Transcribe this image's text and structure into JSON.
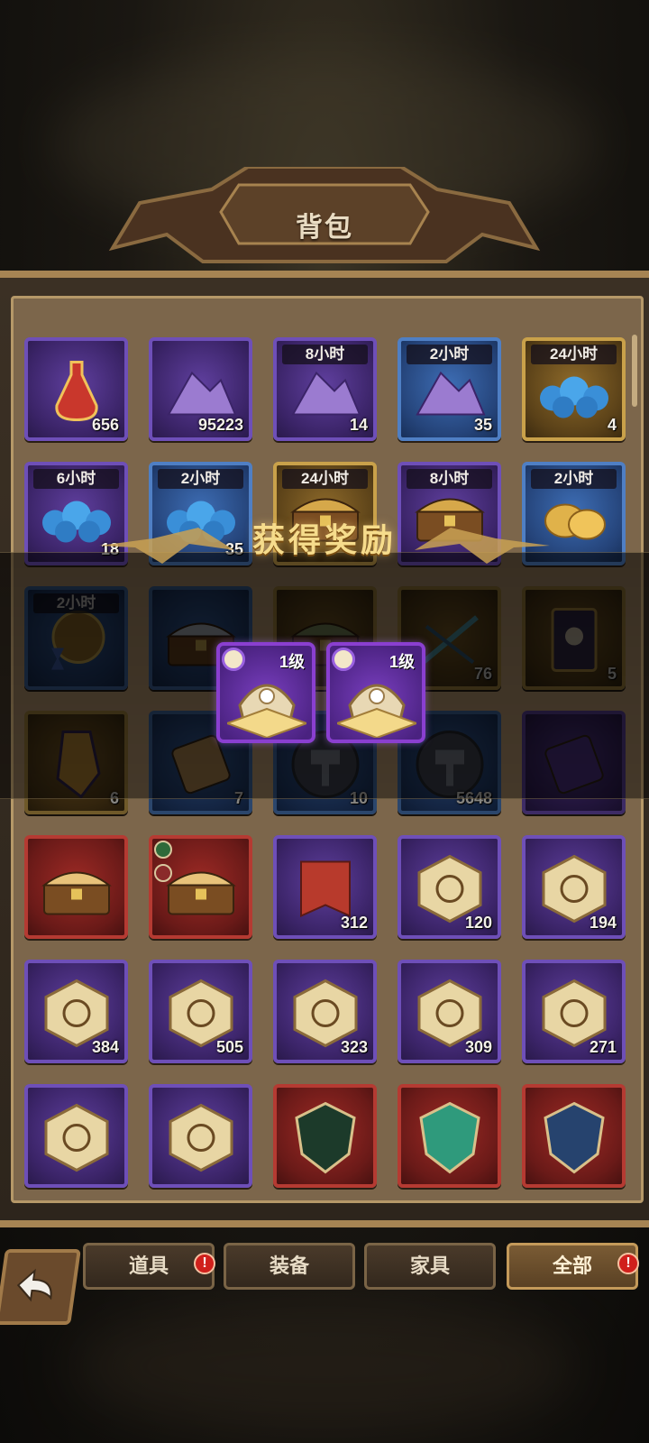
{
  "header": {
    "title": "背包"
  },
  "grid": [
    [
      {
        "name": "potion",
        "count": "656",
        "time": "",
        "style": ""
      },
      {
        "name": "purple-dust",
        "count": "95223",
        "time": "",
        "style": ""
      },
      {
        "name": "dust-chest",
        "count": "14",
        "time": "8小时",
        "style": ""
      },
      {
        "name": "purple-dust-pile",
        "count": "35",
        "time": "2小时",
        "style": "blue"
      },
      {
        "name": "orb-chest",
        "count": "4",
        "time": "24小时",
        "style": "gold"
      }
    ],
    [
      {
        "name": "blue-orbs",
        "count": "18",
        "time": "6小时",
        "style": ""
      },
      {
        "name": "blue-orbs",
        "count": "35",
        "time": "2小时",
        "style": "blue"
      },
      {
        "name": "gold-chest",
        "count": "",
        "time": "24小时",
        "style": "gold"
      },
      {
        "name": "gold-chest",
        "count": "",
        "time": "8小时",
        "style": ""
      },
      {
        "name": "gold-coins",
        "count": "",
        "time": "2小时",
        "style": "blue"
      }
    ],
    [
      {
        "name": "hourglass-compass",
        "count": "",
        "time": "2小时",
        "style": "blue"
      },
      {
        "name": "silver-chest",
        "count": "",
        "time": "",
        "style": "blue"
      },
      {
        "name": "jade-chest",
        "count": "",
        "time": "",
        "style": "gold"
      },
      {
        "name": "bow-weapon",
        "count": "76",
        "time": "",
        "style": "gold"
      },
      {
        "name": "card",
        "count": "5",
        "time": "",
        "style": "gold"
      }
    ],
    [
      {
        "name": "gauntlet",
        "count": "6",
        "time": "",
        "style": "gold"
      },
      {
        "name": "scroll",
        "count": "7",
        "time": "",
        "style": "blue"
      },
      {
        "name": "hammer-coin",
        "count": "10",
        "time": "",
        "style": "blue"
      },
      {
        "name": "hammer-coin",
        "count": "5648",
        "time": "",
        "style": "blue"
      },
      {
        "name": "purple-scroll",
        "count": "",
        "time": "",
        "style": ""
      }
    ],
    [
      {
        "name": "red-chest",
        "count": "",
        "time": "",
        "style": "red"
      },
      {
        "name": "red-chest-tagged",
        "count": "",
        "time": "",
        "style": "red"
      },
      {
        "name": "red-banner",
        "count": "312",
        "time": "",
        "style": ""
      },
      {
        "name": "rune-sun",
        "count": "120",
        "time": "",
        "style": ""
      },
      {
        "name": "rune-star",
        "count": "194",
        "time": "",
        "style": ""
      }
    ],
    [
      {
        "name": "rune-wreath",
        "count": "384",
        "time": "",
        "style": ""
      },
      {
        "name": "rune-serpent",
        "count": "505",
        "time": "",
        "style": ""
      },
      {
        "name": "rune-leaf",
        "count": "323",
        "time": "",
        "style": ""
      },
      {
        "name": "rune-branch",
        "count": "309",
        "time": "",
        "style": ""
      },
      {
        "name": "rune-horn",
        "count": "271",
        "time": "",
        "style": ""
      }
    ],
    [
      {
        "name": "rune-bush",
        "count": "",
        "time": "",
        "style": ""
      },
      {
        "name": "rune-flower",
        "count": "",
        "time": "",
        "style": ""
      },
      {
        "name": "green-shield",
        "count": "",
        "time": "",
        "style": "red"
      },
      {
        "name": "leaf-shield",
        "count": "",
        "time": "",
        "style": "red"
      },
      {
        "name": "star-shield",
        "count": "",
        "time": "",
        "style": "red"
      }
    ]
  ],
  "reward": {
    "title": "获得奖励",
    "items": [
      {
        "level": "1级"
      },
      {
        "level": "1级"
      }
    ]
  },
  "tabs": [
    {
      "label": "道具",
      "alert": "!"
    },
    {
      "label": "装备",
      "alert": ""
    },
    {
      "label": "家具",
      "alert": ""
    },
    {
      "label": "全部",
      "alert": "!"
    }
  ],
  "colors": {
    "rare": "#6e4fb8",
    "blue": "#4f7fc4",
    "gold": "#c9a14a",
    "red": "#b53a32",
    "alert": "#d0201c"
  }
}
